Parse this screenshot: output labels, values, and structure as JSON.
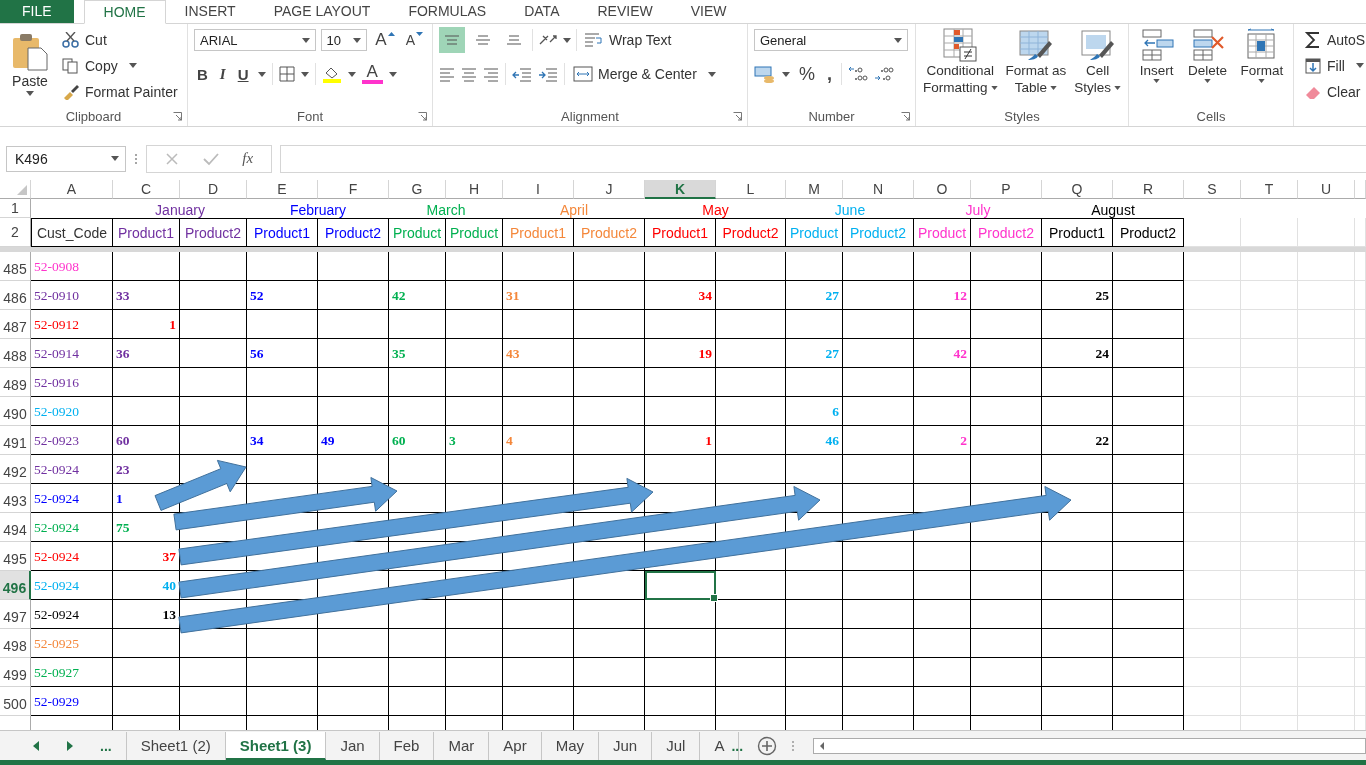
{
  "ribbon_tabs": [
    {
      "label": "FILE",
      "kind": "file",
      "selected": false
    },
    {
      "label": "HOME",
      "kind": "tab",
      "selected": true
    },
    {
      "label": "INSERT",
      "kind": "tab",
      "selected": false
    },
    {
      "label": "PAGE LAYOUT",
      "kind": "tab",
      "selected": false
    },
    {
      "label": "FORMULAS",
      "kind": "tab",
      "selected": false
    },
    {
      "label": "DATA",
      "kind": "tab",
      "selected": false
    },
    {
      "label": "REVIEW",
      "kind": "tab",
      "selected": false
    },
    {
      "label": "VIEW",
      "kind": "tab",
      "selected": false
    }
  ],
  "clipboard": {
    "paste": "Paste",
    "cut": "Cut",
    "copy": "Copy",
    "format_painter": "Format Painter",
    "label": "Clipboard"
  },
  "font": {
    "family": "ARIAL",
    "size": "10",
    "grow": "A",
    "shrink": "A",
    "bold": "B",
    "italic": "I",
    "underline": "U",
    "font_color": "A",
    "label": "Font"
  },
  "alignment": {
    "vertical": [
      {
        "kind": "top",
        "selected": true
      },
      {
        "kind": "middle",
        "selected": false
      },
      {
        "kind": "bottom",
        "selected": false
      }
    ],
    "wrap_text": "Wrap Text",
    "merge_center": "Merge & Center",
    "label": "Alignment"
  },
  "number": {
    "format": "General",
    "percent": "%",
    "comma": ",",
    "label": "Number"
  },
  "styles": {
    "buttons": [
      {
        "kind": "conditional",
        "lines": [
          "Conditional",
          "Formatting"
        ]
      },
      {
        "kind": "table",
        "lines": [
          "Format as",
          "Table"
        ]
      },
      {
        "kind": "cell",
        "lines": [
          "Cell",
          "Styles"
        ]
      }
    ],
    "label": "Styles"
  },
  "cells": {
    "buttons": [
      {
        "kind": "insert",
        "label": "Insert"
      },
      {
        "kind": "delete",
        "label": "Delete"
      },
      {
        "kind": "format",
        "label": "Format"
      }
    ],
    "label": "Cells"
  },
  "editing": {
    "items": [
      {
        "kind": "autosum",
        "label": "AutoS"
      },
      {
        "kind": "fill",
        "label": "Fill"
      },
      {
        "kind": "clear",
        "label": "Clear"
      }
    ]
  },
  "formula_bar": {
    "name_box": "K496",
    "fx": "fx"
  },
  "columns": [
    {
      "label": "A",
      "selected": false
    },
    {
      "label": "C",
      "selected": false
    },
    {
      "label": "D",
      "selected": false
    },
    {
      "label": "E",
      "selected": false
    },
    {
      "label": "F",
      "selected": false
    },
    {
      "label": "G",
      "selected": false
    },
    {
      "label": "H",
      "selected": false
    },
    {
      "label": "I",
      "selected": false
    },
    {
      "label": "J",
      "selected": false
    },
    {
      "label": "K",
      "selected": true
    },
    {
      "label": "L",
      "selected": false
    },
    {
      "label": "M",
      "selected": false
    },
    {
      "label": "N",
      "selected": false
    },
    {
      "label": "O",
      "selected": false
    },
    {
      "label": "P",
      "selected": false
    },
    {
      "label": "Q",
      "selected": false
    },
    {
      "label": "R",
      "selected": false
    },
    {
      "label": "S",
      "selected": false
    },
    {
      "label": "T",
      "selected": false
    },
    {
      "label": "U",
      "selected": false
    }
  ],
  "month_row": {
    "number": "1",
    "months": [
      {
        "label": "January",
        "color": "#7030a0"
      },
      {
        "label": "February",
        "color": "#0000ff"
      },
      {
        "label": "March",
        "color": "#00b050"
      },
      {
        "label": "April",
        "color": "#f4873a"
      },
      {
        "label": "May",
        "color": "#ff0000"
      },
      {
        "label": "June",
        "color": "#00b0f0"
      },
      {
        "label": "July",
        "color": "#ff33cc"
      },
      {
        "label": "August",
        "color": "#000000"
      }
    ]
  },
  "product_row": {
    "number": "2",
    "first": "Cust_Code",
    "products": [
      "Product1",
      "Product2",
      "Product1",
      "Product2",
      "Product",
      "Product",
      "Product1",
      "Product2",
      "Product1",
      "Product2",
      "Product",
      "Product2",
      "Product",
      "Product2",
      "Product1",
      "Product2"
    ]
  },
  "rows": [
    {
      "number": "485",
      "code": "52-0908",
      "color": "#ff33cc",
      "selected": false,
      "values": [
        {
          "kind": "empty"
        },
        {
          "kind": "empty"
        },
        {
          "kind": "empty"
        },
        {
          "kind": "empty"
        },
        {
          "kind": "empty"
        },
        {
          "kind": "empty"
        },
        {
          "kind": "empty"
        },
        {
          "kind": "empty"
        },
        {
          "kind": "empty"
        },
        {
          "kind": "empty"
        },
        {
          "kind": "empty"
        },
        {
          "kind": "empty"
        },
        {
          "kind": "empty"
        },
        {
          "kind": "empty"
        },
        {
          "kind": "empty"
        },
        {
          "kind": "empty"
        }
      ]
    },
    {
      "number": "486",
      "code": "52-0910",
      "color": "#7030a0",
      "selected": false,
      "values": [
        {
          "text": "33",
          "color": "#7030a0",
          "kind": "text"
        },
        {
          "kind": "empty"
        },
        {
          "text": "52",
          "color": "#0000ff",
          "kind": "text"
        },
        {
          "kind": "empty"
        },
        {
          "text": "42",
          "color": "#00b050",
          "kind": "text"
        },
        {
          "kind": "empty"
        },
        {
          "text": "31",
          "color": "#f4873a",
          "kind": "text"
        },
        {
          "kind": "empty"
        },
        {
          "text": "34",
          "color": "#ff0000",
          "kind": "number"
        },
        {
          "kind": "empty"
        },
        {
          "text": "27",
          "color": "#00b0f0",
          "kind": "number"
        },
        {
          "kind": "empty"
        },
        {
          "text": "12",
          "color": "#ff33cc",
          "kind": "number"
        },
        {
          "kind": "empty"
        },
        {
          "text": "25",
          "color": "#000000",
          "kind": "number"
        },
        {
          "kind": "empty"
        }
      ]
    },
    {
      "number": "487",
      "code": "52-0912",
      "color": "#ff0000",
      "selected": false,
      "values": [
        {
          "text": "1",
          "color": "#ff0000",
          "kind": "number"
        },
        {
          "kind": "empty"
        },
        {
          "kind": "empty"
        },
        {
          "kind": "empty"
        },
        {
          "kind": "empty"
        },
        {
          "kind": "empty"
        },
        {
          "kind": "empty"
        },
        {
          "kind": "empty"
        },
        {
          "kind": "empty"
        },
        {
          "kind": "empty"
        },
        {
          "kind": "empty"
        },
        {
          "kind": "empty"
        },
        {
          "kind": "empty"
        },
        {
          "kind": "empty"
        },
        {
          "kind": "empty"
        },
        {
          "kind": "empty"
        }
      ]
    },
    {
      "number": "488",
      "code": "52-0914",
      "color": "#7030a0",
      "selected": false,
      "values": [
        {
          "text": "36",
          "color": "#7030a0",
          "kind": "text"
        },
        {
          "kind": "empty"
        },
        {
          "text": "56",
          "color": "#0000ff",
          "kind": "text"
        },
        {
          "kind": "empty"
        },
        {
          "text": "35",
          "color": "#00b050",
          "kind": "text"
        },
        {
          "kind": "empty"
        },
        {
          "text": "43",
          "color": "#f4873a",
          "kind": "text"
        },
        {
          "kind": "empty"
        },
        {
          "text": "19",
          "color": "#ff0000",
          "kind": "number"
        },
        {
          "kind": "empty"
        },
        {
          "text": "27",
          "color": "#00b0f0",
          "kind": "number"
        },
        {
          "kind": "empty"
        },
        {
          "text": "42",
          "color": "#ff33cc",
          "kind": "number"
        },
        {
          "kind": "empty"
        },
        {
          "text": "24",
          "color": "#000000",
          "kind": "number"
        },
        {
          "kind": "empty"
        }
      ]
    },
    {
      "number": "489",
      "code": "52-0916",
      "color": "#7030a0",
      "selected": false,
      "values": [
        {
          "kind": "empty"
        },
        {
          "kind": "empty"
        },
        {
          "kind": "empty"
        },
        {
          "kind": "empty"
        },
        {
          "kind": "empty"
        },
        {
          "kind": "empty"
        },
        {
          "kind": "empty"
        },
        {
          "kind": "empty"
        },
        {
          "kind": "empty"
        },
        {
          "kind": "empty"
        },
        {
          "kind": "empty"
        },
        {
          "kind": "empty"
        },
        {
          "kind": "empty"
        },
        {
          "kind": "empty"
        },
        {
          "kind": "empty"
        },
        {
          "kind": "empty"
        }
      ]
    },
    {
      "number": "490",
      "code": "52-0920",
      "color": "#00b0f0",
      "selected": false,
      "values": [
        {
          "kind": "empty"
        },
        {
          "kind": "empty"
        },
        {
          "kind": "empty"
        },
        {
          "kind": "empty"
        },
        {
          "kind": "empty"
        },
        {
          "kind": "empty"
        },
        {
          "kind": "empty"
        },
        {
          "kind": "empty"
        },
        {
          "kind": "empty"
        },
        {
          "kind": "empty"
        },
        {
          "text": "6",
          "color": "#00b0f0",
          "kind": "number"
        },
        {
          "kind": "empty"
        },
        {
          "kind": "empty"
        },
        {
          "kind": "empty"
        },
        {
          "kind": "empty"
        },
        {
          "kind": "empty"
        }
      ]
    },
    {
      "number": "491",
      "code": "52-0923",
      "color": "#7030a0",
      "selected": false,
      "values": [
        {
          "text": "60",
          "color": "#7030a0",
          "kind": "text"
        },
        {
          "kind": "empty"
        },
        {
          "text": "34",
          "color": "#0000ff",
          "kind": "text"
        },
        {
          "text": "49",
          "color": "#0000ff",
          "kind": "text"
        },
        {
          "text": "60",
          "color": "#00b050",
          "kind": "text"
        },
        {
          "text": "3",
          "color": "#00b050",
          "kind": "text"
        },
        {
          "text": "4",
          "color": "#f4873a",
          "kind": "text"
        },
        {
          "kind": "empty"
        },
        {
          "text": "1",
          "color": "#ff0000",
          "kind": "number"
        },
        {
          "kind": "empty"
        },
        {
          "text": "46",
          "color": "#00b0f0",
          "kind": "number"
        },
        {
          "kind": "empty"
        },
        {
          "text": "2",
          "color": "#ff33cc",
          "kind": "number"
        },
        {
          "kind": "empty"
        },
        {
          "text": "22",
          "color": "#000000",
          "kind": "number"
        },
        {
          "kind": "empty"
        }
      ]
    },
    {
      "number": "492",
      "code": "52-0924",
      "color": "#7030a0",
      "selected": false,
      "values": [
        {
          "text": "23",
          "color": "#7030a0",
          "kind": "text"
        },
        {
          "kind": "empty"
        },
        {
          "kind": "empty"
        },
        {
          "kind": "empty"
        },
        {
          "kind": "empty"
        },
        {
          "kind": "empty"
        },
        {
          "kind": "empty"
        },
        {
          "kind": "empty"
        },
        {
          "kind": "empty"
        },
        {
          "kind": "empty"
        },
        {
          "kind": "empty"
        },
        {
          "kind": "empty"
        },
        {
          "kind": "empty"
        },
        {
          "kind": "empty"
        },
        {
          "kind": "empty"
        },
        {
          "kind": "empty"
        }
      ]
    },
    {
      "number": "493",
      "code": "52-0924",
      "color": "#0000ff",
      "selected": false,
      "values": [
        {
          "text": "1",
          "color": "#0000ff",
          "kind": "text"
        },
        {
          "kind": "empty"
        },
        {
          "kind": "empty"
        },
        {
          "kind": "empty"
        },
        {
          "kind": "empty"
        },
        {
          "kind": "empty"
        },
        {
          "kind": "empty"
        },
        {
          "kind": "empty"
        },
        {
          "kind": "empty"
        },
        {
          "kind": "empty"
        },
        {
          "kind": "empty"
        },
        {
          "kind": "empty"
        },
        {
          "kind": "empty"
        },
        {
          "kind": "empty"
        },
        {
          "kind": "empty"
        },
        {
          "kind": "empty"
        }
      ]
    },
    {
      "number": "494",
      "code": "52-0924",
      "color": "#00b050",
      "selected": false,
      "values": [
        {
          "text": "75",
          "color": "#00b050",
          "kind": "text"
        },
        {
          "kind": "empty"
        },
        {
          "kind": "empty"
        },
        {
          "kind": "empty"
        },
        {
          "kind": "empty"
        },
        {
          "kind": "empty"
        },
        {
          "kind": "empty"
        },
        {
          "kind": "empty"
        },
        {
          "kind": "empty"
        },
        {
          "kind": "empty"
        },
        {
          "kind": "empty"
        },
        {
          "kind": "empty"
        },
        {
          "kind": "empty"
        },
        {
          "kind": "empty"
        },
        {
          "kind": "empty"
        },
        {
          "kind": "empty"
        }
      ]
    },
    {
      "number": "495",
      "code": "52-0924",
      "color": "#ff0000",
      "selected": false,
      "values": [
        {
          "text": "37",
          "color": "#ff0000",
          "kind": "number"
        },
        {
          "kind": "empty"
        },
        {
          "kind": "empty"
        },
        {
          "kind": "empty"
        },
        {
          "kind": "empty"
        },
        {
          "kind": "empty"
        },
        {
          "kind": "empty"
        },
        {
          "kind": "empty"
        },
        {
          "kind": "empty"
        },
        {
          "kind": "empty"
        },
        {
          "kind": "empty"
        },
        {
          "kind": "empty"
        },
        {
          "kind": "empty"
        },
        {
          "kind": "empty"
        },
        {
          "kind": "empty"
        },
        {
          "kind": "empty"
        }
      ]
    },
    {
      "number": "496",
      "code": "52-0924",
      "color": "#00b0f0",
      "selected": true,
      "values": [
        {
          "text": "40",
          "color": "#00b0f0",
          "kind": "number"
        },
        {
          "kind": "empty"
        },
        {
          "kind": "empty"
        },
        {
          "kind": "empty"
        },
        {
          "kind": "empty"
        },
        {
          "kind": "empty"
        },
        {
          "kind": "empty"
        },
        {
          "kind": "empty"
        },
        {
          "kind": "empty"
        },
        {
          "kind": "empty"
        },
        {
          "kind": "empty"
        },
        {
          "kind": "empty"
        },
        {
          "kind": "empty"
        },
        {
          "kind": "empty"
        },
        {
          "kind": "empty"
        },
        {
          "kind": "empty"
        }
      ]
    },
    {
      "number": "497",
      "code": "52-0924",
      "color": "#000000",
      "selected": false,
      "values": [
        {
          "text": "13",
          "color": "#000000",
          "kind": "number"
        },
        {
          "kind": "empty"
        },
        {
          "kind": "empty"
        },
        {
          "kind": "empty"
        },
        {
          "kind": "empty"
        },
        {
          "kind": "empty"
        },
        {
          "kind": "empty"
        },
        {
          "kind": "empty"
        },
        {
          "kind": "empty"
        },
        {
          "kind": "empty"
        },
        {
          "kind": "empty"
        },
        {
          "kind": "empty"
        },
        {
          "kind": "empty"
        },
        {
          "kind": "empty"
        },
        {
          "kind": "empty"
        },
        {
          "kind": "empty"
        }
      ]
    },
    {
      "number": "498",
      "code": "52-0925",
      "color": "#f4873a",
      "selected": false,
      "values": [
        {
          "kind": "empty"
        },
        {
          "kind": "empty"
        },
        {
          "kind": "empty"
        },
        {
          "kind": "empty"
        },
        {
          "kind": "empty"
        },
        {
          "kind": "empty"
        },
        {
          "kind": "empty"
        },
        {
          "kind": "empty"
        },
        {
          "kind": "empty"
        },
        {
          "kind": "empty"
        },
        {
          "kind": "empty"
        },
        {
          "kind": "empty"
        },
        {
          "kind": "empty"
        },
        {
          "kind": "empty"
        },
        {
          "kind": "empty"
        },
        {
          "kind": "empty"
        }
      ]
    },
    {
      "number": "499",
      "code": "52-0927",
      "color": "#00b050",
      "selected": false,
      "values": [
        {
          "kind": "empty"
        },
        {
          "kind": "empty"
        },
        {
          "kind": "empty"
        },
        {
          "kind": "empty"
        },
        {
          "kind": "empty"
        },
        {
          "kind": "empty"
        },
        {
          "kind": "empty"
        },
        {
          "kind": "empty"
        },
        {
          "kind": "empty"
        },
        {
          "kind": "empty"
        },
        {
          "kind": "empty"
        },
        {
          "kind": "empty"
        },
        {
          "kind": "empty"
        },
        {
          "kind": "empty"
        },
        {
          "kind": "empty"
        },
        {
          "kind": "empty"
        }
      ]
    },
    {
      "number": "500",
      "code": "52-0929",
      "color": "#0000ff",
      "selected": false,
      "values": [
        {
          "kind": "empty"
        },
        {
          "kind": "empty"
        },
        {
          "kind": "empty"
        },
        {
          "kind": "empty"
        },
        {
          "kind": "empty"
        },
        {
          "kind": "empty"
        },
        {
          "kind": "empty"
        },
        {
          "kind": "empty"
        },
        {
          "kind": "empty"
        },
        {
          "kind": "empty"
        },
        {
          "kind": "empty"
        },
        {
          "kind": "empty"
        },
        {
          "kind": "empty"
        },
        {
          "kind": "empty"
        },
        {
          "kind": "empty"
        },
        {
          "kind": "empty"
        }
      ]
    }
  ],
  "arrows": [
    {
      "kind": "block-arrow"
    },
    {
      "kind": "block-arrow"
    },
    {
      "kind": "block-arrow"
    },
    {
      "kind": "block-arrow"
    },
    {
      "kind": "block-arrow"
    }
  ],
  "sheet_tabs": {
    "more_left": "...",
    "tabs": [
      {
        "label": "Sheet1 (2)",
        "selected": false
      },
      {
        "label": "Sheet1 (3)",
        "selected": true
      },
      {
        "label": "Jan",
        "selected": false
      },
      {
        "label": "Feb",
        "selected": false
      },
      {
        "label": "Mar",
        "selected": false
      },
      {
        "label": "Apr",
        "selected": false
      },
      {
        "label": "May",
        "selected": false
      },
      {
        "label": "Jun",
        "selected": false
      },
      {
        "label": "Jul",
        "selected": false
      },
      {
        "label": "A",
        "selected": false
      }
    ],
    "more_right": "..."
  }
}
